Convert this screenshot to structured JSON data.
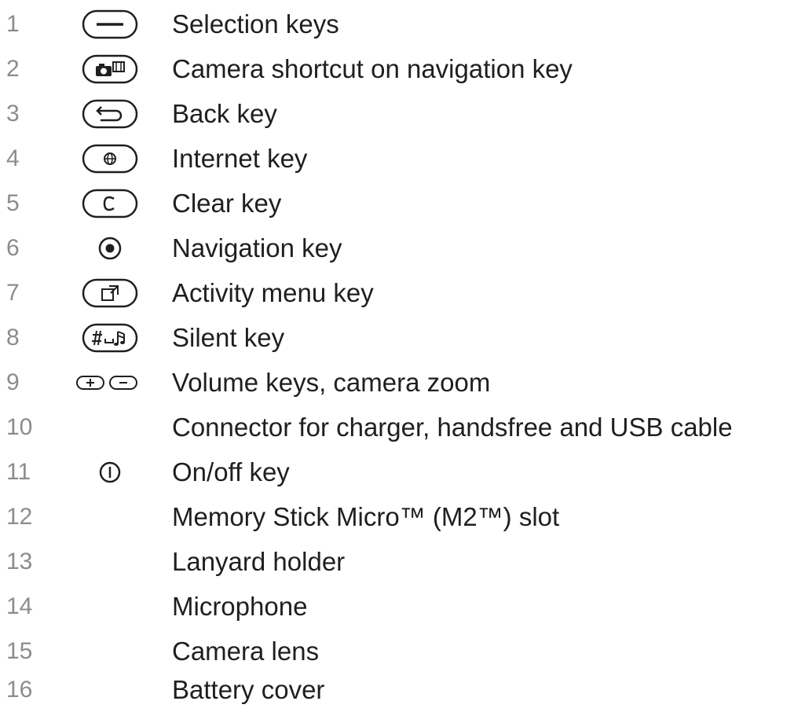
{
  "items": [
    {
      "number": "1",
      "label": "Selection keys",
      "icon": "selection-key-icon"
    },
    {
      "number": "2",
      "label": "Camera shortcut on navigation key",
      "icon": "camera-shortcut-icon"
    },
    {
      "number": "3",
      "label": "Back key",
      "icon": "back-key-icon"
    },
    {
      "number": "4",
      "label": "Internet key",
      "icon": "internet-key-icon"
    },
    {
      "number": "5",
      "label": "Clear key",
      "icon": "clear-key-icon"
    },
    {
      "number": "6",
      "label": "Navigation key",
      "icon": "navigation-key-icon"
    },
    {
      "number": "7",
      "label": "Activity menu key",
      "icon": "activity-menu-key-icon"
    },
    {
      "number": "8",
      "label": "Silent key",
      "icon": "silent-key-icon"
    },
    {
      "number": "9",
      "label": "Volume keys, camera zoom",
      "icon": "volume-keys-icon"
    },
    {
      "number": "10",
      "label": "Connector for charger, handsfree and USB cable",
      "icon": ""
    },
    {
      "number": "11",
      "label": "On/off key",
      "icon": "power-key-icon"
    },
    {
      "number": "12",
      "label": "Memory Stick Micro™ (M2™) slot",
      "icon": ""
    },
    {
      "number": "13",
      "label": "Lanyard holder",
      "icon": ""
    },
    {
      "number": "14",
      "label": "Microphone",
      "icon": ""
    },
    {
      "number": "15",
      "label": "Camera lens",
      "icon": ""
    },
    {
      "number": "16",
      "label": "Battery cover",
      "icon": ""
    }
  ],
  "colors": {
    "number": "#8c8c8c",
    "text": "#1f1f1f",
    "icon": "#1f1f1f"
  }
}
